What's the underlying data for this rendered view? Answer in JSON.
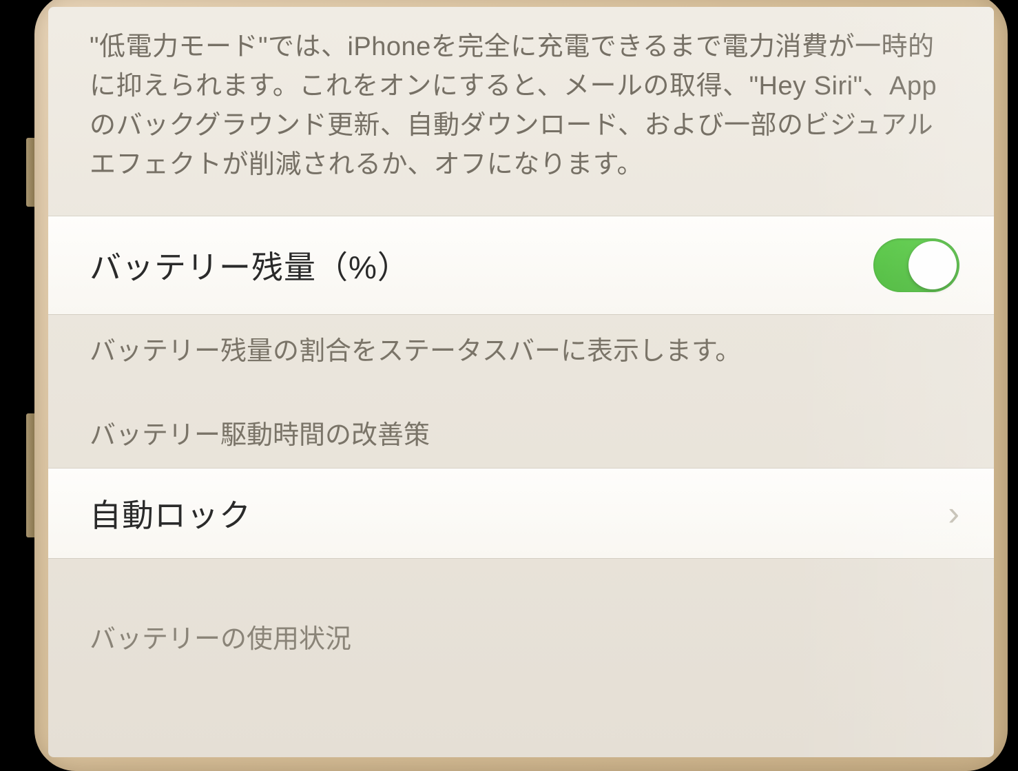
{
  "sections": {
    "low_power_description": "\"低電力モード\"では、iPhoneを完全に充電できるまで電力消費が一時的に抑えられます。これをオンにすると、メールの取得、\"Hey Siri\"、Appのバックグラウンド更新、自動ダウンロード、および一部のビジュアルエフェクトが削減されるか、オフになります。",
    "battery_percentage": {
      "label": "バッテリー残量（%）",
      "enabled": true,
      "footer": "バッテリー残量の割合をステータスバーに表示します。"
    },
    "battery_life_suggestions_header": "バッテリー駆動時間の改善策",
    "auto_lock": {
      "label": "自動ロック"
    },
    "battery_usage_header": "バッテリーの使用状況"
  },
  "colors": {
    "toggle_on": "#4CD964",
    "background": "#EFEFF4",
    "text_primary": "#000000",
    "text_secondary": "#6D6D72"
  }
}
